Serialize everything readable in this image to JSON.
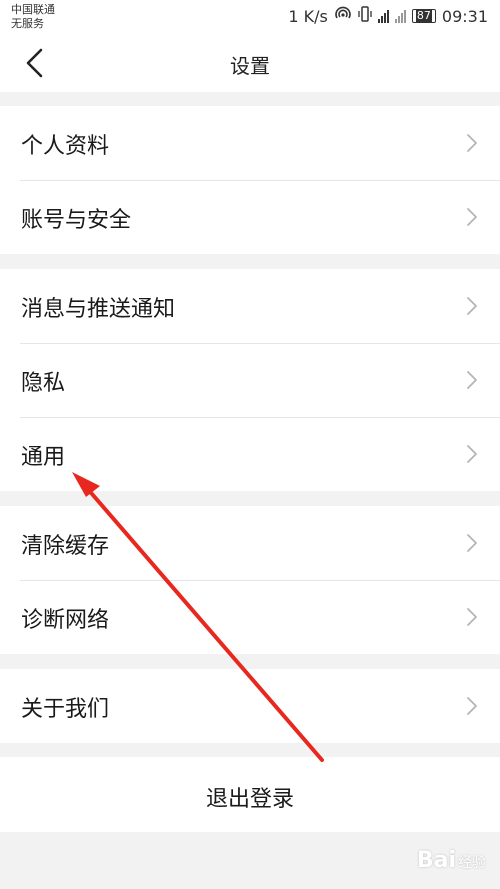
{
  "status_bar": {
    "carrier_line1": "中国联通",
    "carrier_line2": "无服务",
    "net_speed": "1 K/s",
    "battery": "87",
    "time": "09:31"
  },
  "nav": {
    "title": "设置",
    "back_icon": "chevron-left-icon"
  },
  "groups": [
    {
      "items": [
        {
          "label": "个人资料"
        },
        {
          "label": "账号与安全"
        }
      ]
    },
    {
      "items": [
        {
          "label": "消息与推送通知"
        },
        {
          "label": "隐私"
        },
        {
          "label": "通用"
        }
      ]
    },
    {
      "items": [
        {
          "label": "清除缓存"
        },
        {
          "label": "诊断网络"
        }
      ]
    },
    {
      "items": [
        {
          "label": "关于我们"
        }
      ]
    }
  ],
  "logout_label": "退出登录",
  "watermark": {
    "brand": "Bai",
    "suffix": "经验"
  },
  "colors": {
    "page_bg": "#f2f2f2",
    "card_bg": "#ffffff",
    "annotation_arrow": "#e8281e"
  }
}
